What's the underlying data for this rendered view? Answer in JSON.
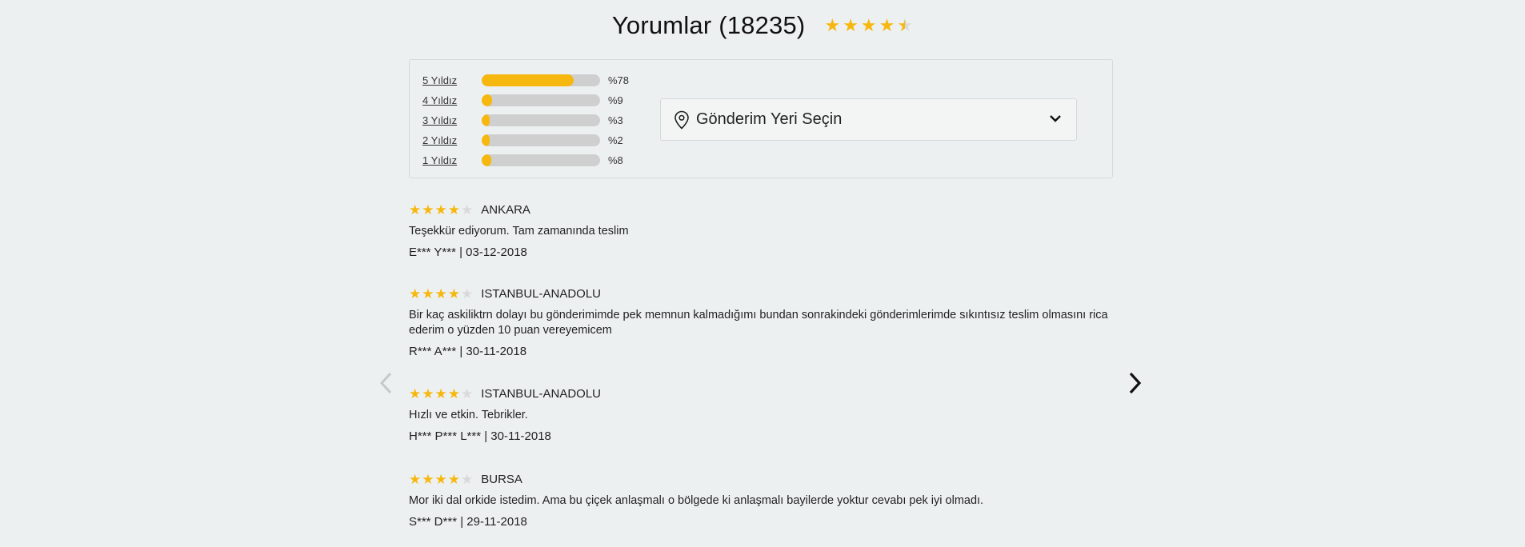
{
  "header": {
    "title": "Yorumlar (18235)",
    "rating": 4.5
  },
  "distribution": [
    {
      "label": "5 Yıldız",
      "pct_label": "%78",
      "fill": 0.78
    },
    {
      "label": "4 Yıldız",
      "pct_label": "%9",
      "fill": 0.09
    },
    {
      "label": "3 Yıldız",
      "pct_label": "%3",
      "fill": 0.03
    },
    {
      "label": "2 Yıldız",
      "pct_label": "%2",
      "fill": 0.02
    },
    {
      "label": "1 Yıldız",
      "pct_label": "%8",
      "fill": 0.08
    }
  ],
  "dropdown": {
    "label": "Gönderim Yeri Seçin",
    "icon": "location-pin-icon"
  },
  "reviews": [
    {
      "rating": 4,
      "city": "ANKARA",
      "text": "Teşekkür ediyorum. Tam zamanında teslim",
      "meta": "E*** Y*** | 03-12-2018"
    },
    {
      "rating": 4,
      "city": "ISTANBUL-ANADOLU",
      "text": "Bir kaç askiliktrn dolayı bu gönderimimde pek memnun kalmadığımı bundan sonrakindeki gönderimlerimde sıkıntısız teslim olmasını rica ederim o yüzden 10 puan vereyemicem",
      "meta": "R*** A*** | 30-11-2018"
    },
    {
      "rating": 4,
      "city": "ISTANBUL-ANADOLU",
      "text": "Hızlı ve etkin. Tebrikler.",
      "meta": "H*** P*** L*** | 30-11-2018"
    },
    {
      "rating": 4,
      "city": "BURSA",
      "text": "Mor iki dal orkide istedim. Ama bu çiçek anlaşmalı o bölgede ki anlaşmalı bayilerde yoktur cevabı pek iyi olmadı.",
      "meta": "S*** D*** | 29-11-2018"
    }
  ],
  "colors": {
    "star": "#f6b80f",
    "star_empty": "#d9d9d9",
    "bar_track": "#cfcfcf",
    "background": "#edf0f1"
  },
  "nav": {
    "prev_icon": "chevron-left-icon",
    "next_icon": "chevron-right-icon"
  }
}
